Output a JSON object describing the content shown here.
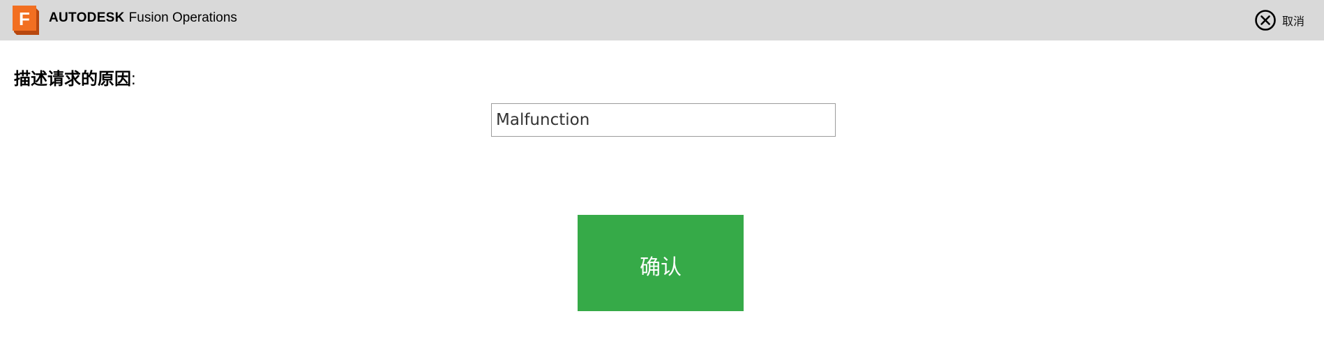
{
  "header": {
    "company": "AUTODESK",
    "product": "Fusion Operations",
    "logo_letter": "F",
    "logo_icon": "autodesk-fusion-logo-icon",
    "cancel_label": "取消",
    "cancel_icon": "close-circle-icon"
  },
  "form": {
    "prompt": "描述请求的原因",
    "prompt_suffix": ":",
    "reason_value": "Malfunction",
    "confirm_label": "确认"
  },
  "colors": {
    "header_bg": "#d9d9d9",
    "logo_orange": "#f26f21",
    "confirm_green": "#36aa48",
    "input_border": "#9b9b9b"
  }
}
